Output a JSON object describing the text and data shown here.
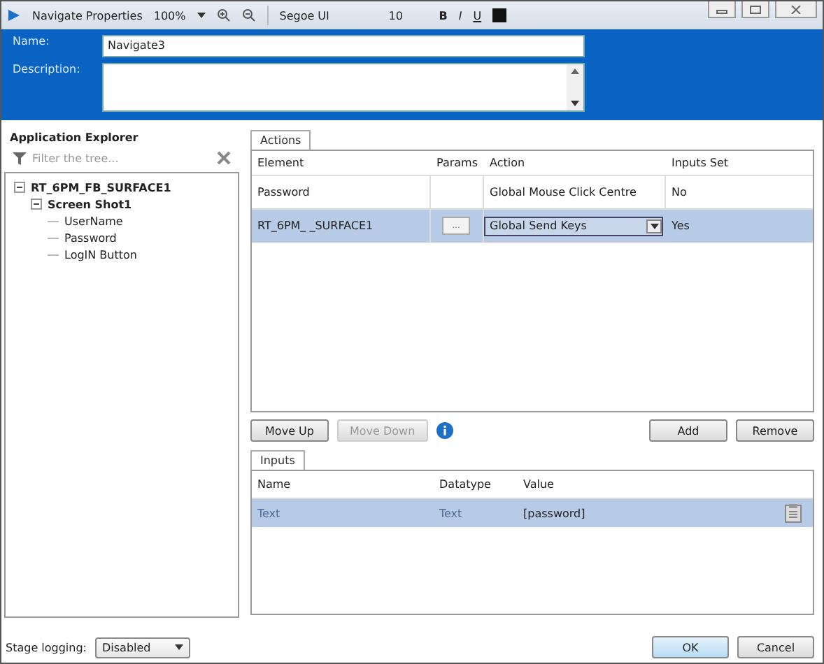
{
  "window": {
    "title": "Navigate Properties"
  },
  "toolbar": {
    "zoom": "100%",
    "font": "Segoe UI",
    "size": "10",
    "bold": "B",
    "italic": "I",
    "underline": "U"
  },
  "header": {
    "name_label": "Name:",
    "name_value": "Navigate3",
    "description_label": "Description:"
  },
  "explorer": {
    "title": "Application Explorer",
    "filter_placeholder": "Filter the tree...",
    "tree": [
      {
        "label": "RT_6PM_FB_SURFACE1",
        "expanded": true,
        "children": [
          {
            "label": "Screen Shot1",
            "expanded": true,
            "children": [
              {
                "label": "UserName"
              },
              {
                "label": "Password"
              },
              {
                "label": "LogIN Button"
              }
            ]
          }
        ]
      }
    ]
  },
  "actions": {
    "tab": "Actions",
    "columns": [
      "Element",
      "Params",
      "Action",
      "Inputs Set"
    ],
    "rows": [
      {
        "element": "Password",
        "action": "Global Mouse Click Centre",
        "inputs_set": "No",
        "selected": false
      },
      {
        "element": "RT_6PM_ _SURFACE1",
        "params": "...",
        "action": "Global Send Keys",
        "inputs_set": "Yes",
        "selected": true
      }
    ]
  },
  "order_buttons": [
    {
      "label": "Move Up",
      "disabled": false
    },
    {
      "label": "Move Down",
      "disabled": true
    }
  ],
  "edit_buttons": [
    {
      "label": "Add",
      "disabled": false
    },
    {
      "label": "Remove",
      "disabled": false
    }
  ],
  "inputs": {
    "tab": "Inputs",
    "columns": [
      "Name",
      "Datatype",
      "Value"
    ],
    "rows": [
      {
        "name": "Text",
        "datatype": "Text",
        "value": "[password]",
        "selected": true
      }
    ]
  },
  "footer": {
    "stage_logging_label": "Stage logging:",
    "stage_logging_value": "Disabled",
    "buttons": [
      {
        "label": "OK",
        "default": true
      },
      {
        "label": "Cancel",
        "default": false
      }
    ]
  }
}
